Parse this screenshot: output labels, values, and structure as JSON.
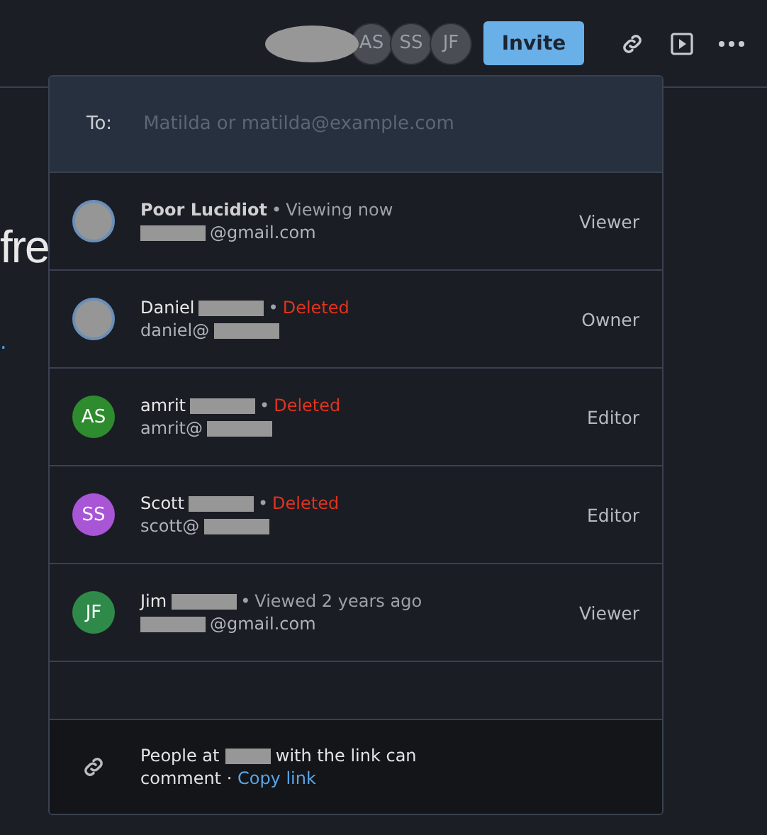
{
  "header": {
    "avatars": [
      {
        "kind": "initials",
        "initials": "AS"
      },
      {
        "kind": "initials",
        "initials": "SS"
      },
      {
        "kind": "initials",
        "initials": "JF"
      }
    ],
    "invite_button": "Invite"
  },
  "document": {
    "heading_fragment": "fre",
    "link_fragment": "."
  },
  "share_dialog": {
    "to_label": "To:",
    "placeholder": "Matilda or matilda@example.com",
    "people": [
      {
        "avatar": {
          "kind": "photo"
        },
        "name": [
          {
            "kind": "text",
            "text": "Poor Lucidiot"
          }
        ],
        "name_bold": true,
        "separator": "•",
        "status": "Viewing now",
        "deleted": false,
        "email": [
          {
            "kind": "redacted"
          },
          {
            "kind": "text",
            "text": "@gmail.com"
          }
        ],
        "role": "Viewer"
      },
      {
        "avatar": {
          "kind": "photo"
        },
        "name": [
          {
            "kind": "text",
            "text": "Daniel"
          },
          {
            "kind": "redacted"
          }
        ],
        "name_bold": false,
        "separator": "•",
        "status": "Deleted",
        "deleted": true,
        "email": [
          {
            "kind": "text",
            "text": "daniel@"
          },
          {
            "kind": "redacted"
          }
        ],
        "role": "Owner"
      },
      {
        "avatar": {
          "kind": "initials",
          "initials": "AS",
          "color": "#2e8b2e"
        },
        "name": [
          {
            "kind": "text",
            "text": "amrit"
          },
          {
            "kind": "redacted"
          }
        ],
        "name_bold": false,
        "separator": "•",
        "status": "Deleted",
        "deleted": true,
        "email": [
          {
            "kind": "text",
            "text": "amrit@"
          },
          {
            "kind": "redacted"
          }
        ],
        "role": "Editor"
      },
      {
        "avatar": {
          "kind": "initials",
          "initials": "SS",
          "color": "#a855d6"
        },
        "name": [
          {
            "kind": "text",
            "text": "Scott"
          },
          {
            "kind": "redacted"
          }
        ],
        "name_bold": false,
        "separator": "•",
        "status": "Deleted",
        "deleted": true,
        "email": [
          {
            "kind": "text",
            "text": "scott@"
          },
          {
            "kind": "redacted"
          }
        ],
        "role": "Editor"
      },
      {
        "avatar": {
          "kind": "initials",
          "initials": "JF",
          "color": "#2f8a4a"
        },
        "name": [
          {
            "kind": "text",
            "text": "Jim"
          },
          {
            "kind": "redacted"
          }
        ],
        "name_bold": false,
        "separator": "•",
        "status": "Viewed 2 years ago",
        "deleted": false,
        "email": [
          {
            "kind": "redacted"
          },
          {
            "kind": "text",
            "text": "@gmail.com"
          }
        ],
        "role": "Viewer"
      }
    ],
    "footer": {
      "text": [
        {
          "kind": "text",
          "text": "People at"
        },
        {
          "kind": "redacted"
        },
        {
          "kind": "text",
          "text": "with the link can comment ·"
        }
      ],
      "copy_link": "Copy link"
    }
  }
}
